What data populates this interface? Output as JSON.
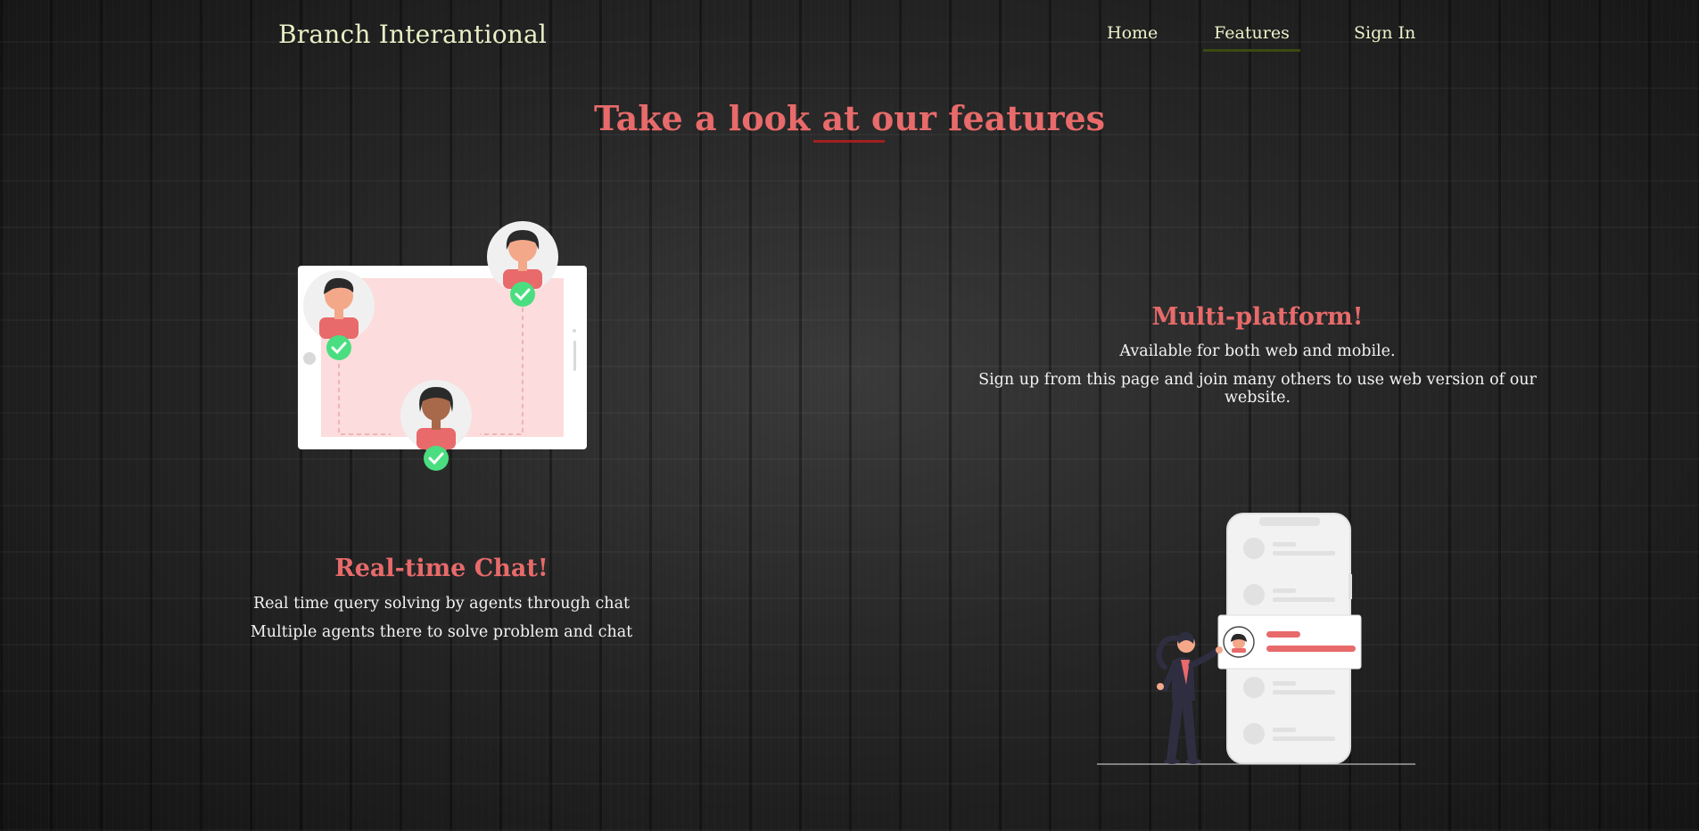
{
  "navbar": {
    "brand": "Branch Interantional",
    "links": [
      "Home",
      "Features",
      "Sign In"
    ],
    "active": "Features"
  },
  "page": {
    "title": "Take a look at our features"
  },
  "features": [
    {
      "title": "Real-time Chat!",
      "lines": [
        "Real time query solving by agents through chat",
        "Multiple agents there to solve problem and chat"
      ]
    },
    {
      "title": "Multi-platform!",
      "lines": [
        "Available for both web and mobile.",
        "Sign up from this page and join many others to use web version of our website."
      ]
    }
  ],
  "colors": {
    "accent": "#e86a6a",
    "nav_text": "#eaf3c8",
    "underline": "#a11f1f",
    "check": "#4ade80"
  }
}
